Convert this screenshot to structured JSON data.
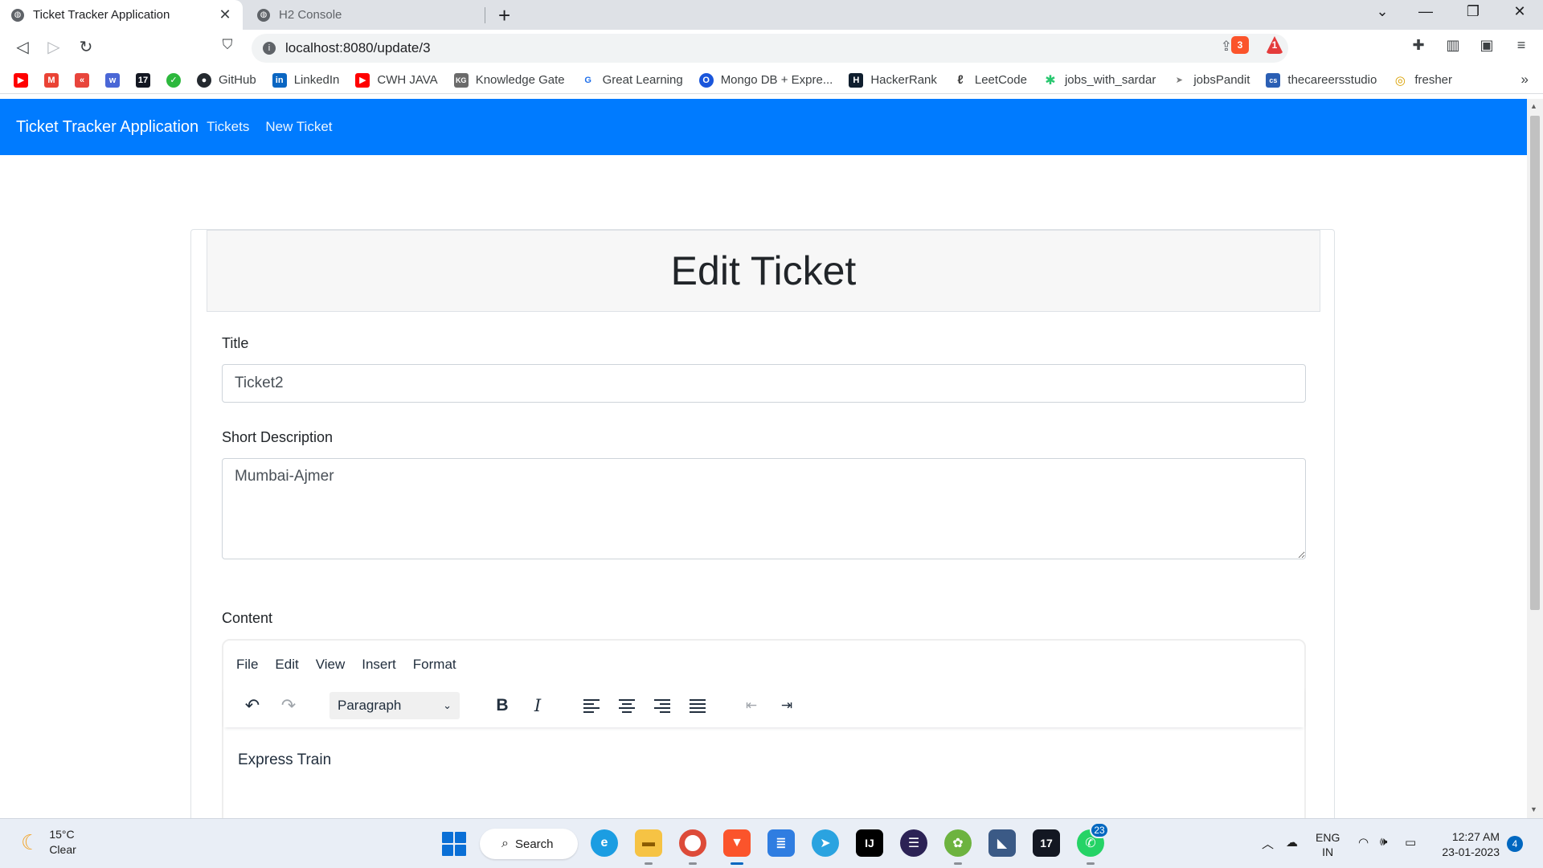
{
  "browser": {
    "tabs": [
      {
        "title": "Ticket Tracker Application",
        "active": true
      },
      {
        "title": "H2 Console",
        "active": false
      }
    ],
    "close_glyph": "✕",
    "new_tab_glyph": "+",
    "url": "localhost:8080/update/3",
    "extension_badges": {
      "brave_shields": "3",
      "brave_rewards": "1"
    }
  },
  "bookmarks": [
    {
      "label": "",
      "icon": "youtube-icon",
      "color": "#ff0000",
      "glyph": "▶"
    },
    {
      "label": "",
      "icon": "gmail-icon",
      "color": "#ea4335",
      "glyph": "M"
    },
    {
      "label": "",
      "icon": "codechef-icon",
      "color": "#e8453c",
      "glyph": "«"
    },
    {
      "label": "",
      "icon": "w-icon",
      "color": "#4a67d6",
      "glyph": "w"
    },
    {
      "label": "",
      "icon": "tradingview-icon",
      "color": "#131722",
      "glyph": "17"
    },
    {
      "label": "",
      "icon": "green-leaf-icon",
      "color": "#2db83d",
      "glyph": "✓"
    },
    {
      "label": "GitHub",
      "icon": "github-icon",
      "color": "#24292f",
      "glyph": "●"
    },
    {
      "label": "LinkedIn",
      "icon": "linkedin-icon",
      "color": "#0a66c2",
      "glyph": "in"
    },
    {
      "label": "CWH JAVA",
      "icon": "youtube-icon",
      "color": "#ff0000",
      "glyph": "▶"
    },
    {
      "label": "Knowledge Gate",
      "icon": "knowledge-gate-icon",
      "color": "#6b6b6b",
      "glyph": "KG"
    },
    {
      "label": "Great Learning",
      "icon": "great-learning-icon",
      "color": "#1f6feb",
      "glyph": "G"
    },
    {
      "label": "Mongo DB + Expre...",
      "icon": "mongo-icon",
      "color": "#1a56db",
      "glyph": "O"
    },
    {
      "label": "HackerRank",
      "icon": "hackerrank-icon",
      "color": "#0f1e2e",
      "glyph": "H"
    },
    {
      "label": "LeetCode",
      "icon": "leetcode-icon",
      "color": "#3c3c3c",
      "glyph": "ℓ"
    },
    {
      "label": "jobs_with_sardar",
      "icon": "sardar-icon",
      "color": "#28c76f",
      "glyph": "✱"
    },
    {
      "label": "jobsPandit",
      "icon": "jobspandit-icon",
      "color": "#7a7a7a",
      "glyph": "➤"
    },
    {
      "label": "thecareersstudio",
      "icon": "careersstudio-icon",
      "color": "#2b5fb4",
      "glyph": "cs"
    },
    {
      "label": "fresher",
      "icon": "fresher-icon",
      "color": "#d9a000",
      "glyph": "◎"
    }
  ],
  "navbar": {
    "brand": "Ticket Tracker Application",
    "links": [
      "Tickets",
      "New Ticket"
    ],
    "color": "#007bff"
  },
  "form": {
    "heading": "Edit Ticket",
    "title_label": "Title",
    "title_value": "Ticket2",
    "short_description_label": "Short Description",
    "short_description_value": "Mumbai-Ajmer",
    "content_label": "Content"
  },
  "editor": {
    "menu": [
      "File",
      "Edit",
      "View",
      "Insert",
      "Format"
    ],
    "block_format": "Paragraph",
    "body_text": "Express Train"
  },
  "taskbar": {
    "weather_temp": "15°C",
    "weather_desc": "Clear",
    "search_label": "Search",
    "whatsapp_badge": "23",
    "lang_top": "ENG",
    "lang_bottom": "IN",
    "time": "12:27 AM",
    "date": "23-01-2023",
    "notification_count": "4"
  }
}
